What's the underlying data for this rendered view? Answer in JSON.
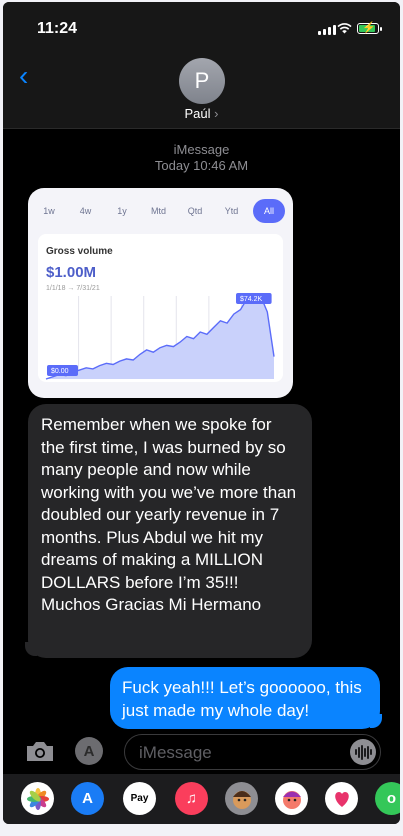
{
  "status": {
    "time": "11:24"
  },
  "nav": {
    "back_icon": "chevron-left-icon",
    "avatar_initial": "P",
    "contact_name": "Paúl",
    "contact_chevron": "›"
  },
  "thread": {
    "service": "iMessage",
    "timestamp": "Today 10:46 AM"
  },
  "attachment": {
    "tabs": [
      "1w",
      "4w",
      "1y",
      "Mtd",
      "Qtd",
      "Ytd",
      "All"
    ],
    "active_tab": "All",
    "label": "Gross volume",
    "value": "$1.00M",
    "range": "1/1/18 → 7/31/21",
    "chart_data": {
      "type": "area",
      "start_label": "$0.00",
      "peak_label": "$74.2K",
      "values": [
        0,
        2,
        4,
        3,
        6,
        8,
        10,
        9,
        12,
        14,
        13,
        16,
        18,
        17,
        22,
        26,
        24,
        28,
        30,
        29,
        33,
        38,
        36,
        42,
        40,
        46,
        52,
        50,
        58,
        62,
        72,
        70,
        74.2,
        60,
        20
      ],
      "color": "#5b6cf9",
      "grid": true
    }
  },
  "messages": {
    "incoming": "Remember when we spoke for the first time, I was burned by so many people and now while working with you we’ve more than doubled our yearly revenue in 7 months. Plus Abdul we hit my dreams of making a MILLION DOLLARS before I’m 35!!! Muchos Gracias Mi Hermano",
    "outgoing": "Fuck yeah!!! Let’s goooooo, this just made my whole day!"
  },
  "composer": {
    "placeholder": "iMessage"
  },
  "app_drawer": {
    "items": [
      {
        "name": "photos-app-icon"
      },
      {
        "name": "app-store-icon"
      },
      {
        "name": "apple-pay-icon",
        "label": "Pay"
      },
      {
        "name": "music-icon"
      },
      {
        "name": "memoji-icon"
      },
      {
        "name": "memoji-stickers-icon"
      },
      {
        "name": "digital-touch-icon"
      },
      {
        "name": "more-apps-icon"
      }
    ]
  }
}
